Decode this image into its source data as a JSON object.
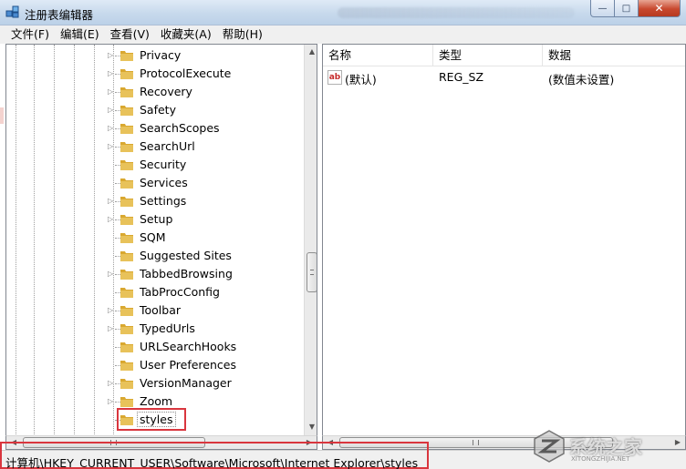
{
  "window": {
    "title": "注册表编辑器",
    "min_glyph": "—",
    "max_glyph": "□",
    "close_glyph": "✕"
  },
  "menu": [
    "文件(F)",
    "编辑(E)",
    "查看(V)",
    "收藏夹(A)",
    "帮助(H)"
  ],
  "tree": {
    "items": [
      {
        "label": "Privacy",
        "expandable": true
      },
      {
        "label": "ProtocolExecute",
        "expandable": true
      },
      {
        "label": "Recovery",
        "expandable": true
      },
      {
        "label": "Safety",
        "expandable": true
      },
      {
        "label": "SearchScopes",
        "expandable": true
      },
      {
        "label": "SearchUrl",
        "expandable": true
      },
      {
        "label": "Security",
        "expandable": false
      },
      {
        "label": "Services",
        "expandable": false
      },
      {
        "label": "Settings",
        "expandable": true
      },
      {
        "label": "Setup",
        "expandable": true
      },
      {
        "label": "SQM",
        "expandable": false
      },
      {
        "label": "Suggested Sites",
        "expandable": false
      },
      {
        "label": "TabbedBrowsing",
        "expandable": true
      },
      {
        "label": "TabProcConfig",
        "expandable": false
      },
      {
        "label": "Toolbar",
        "expandable": true
      },
      {
        "label": "TypedUrls",
        "expandable": true
      },
      {
        "label": "URLSearchHooks",
        "expandable": false
      },
      {
        "label": "User Preferences",
        "expandable": false
      },
      {
        "label": "VersionManager",
        "expandable": true
      },
      {
        "label": "Zoom",
        "expandable": true
      },
      {
        "label": "styles",
        "expandable": false,
        "selected": true
      }
    ]
  },
  "list": {
    "headers": {
      "name": "名称",
      "type": "类型",
      "data": "数据"
    },
    "rows": [
      {
        "icon": "ab",
        "name": "(默认)",
        "type": "REG_SZ",
        "data": "(数值未设置)"
      }
    ]
  },
  "status": {
    "path": "计算机\\HKEY_CURRENT_USER\\Software\\Microsoft\\Internet Explorer\\styles"
  },
  "watermark": {
    "text": "系统之家",
    "sub": "XITONGZHIJIA.NET"
  },
  "colors": {
    "highlight_box": "#d9363e",
    "folder": "#e8c25a"
  }
}
